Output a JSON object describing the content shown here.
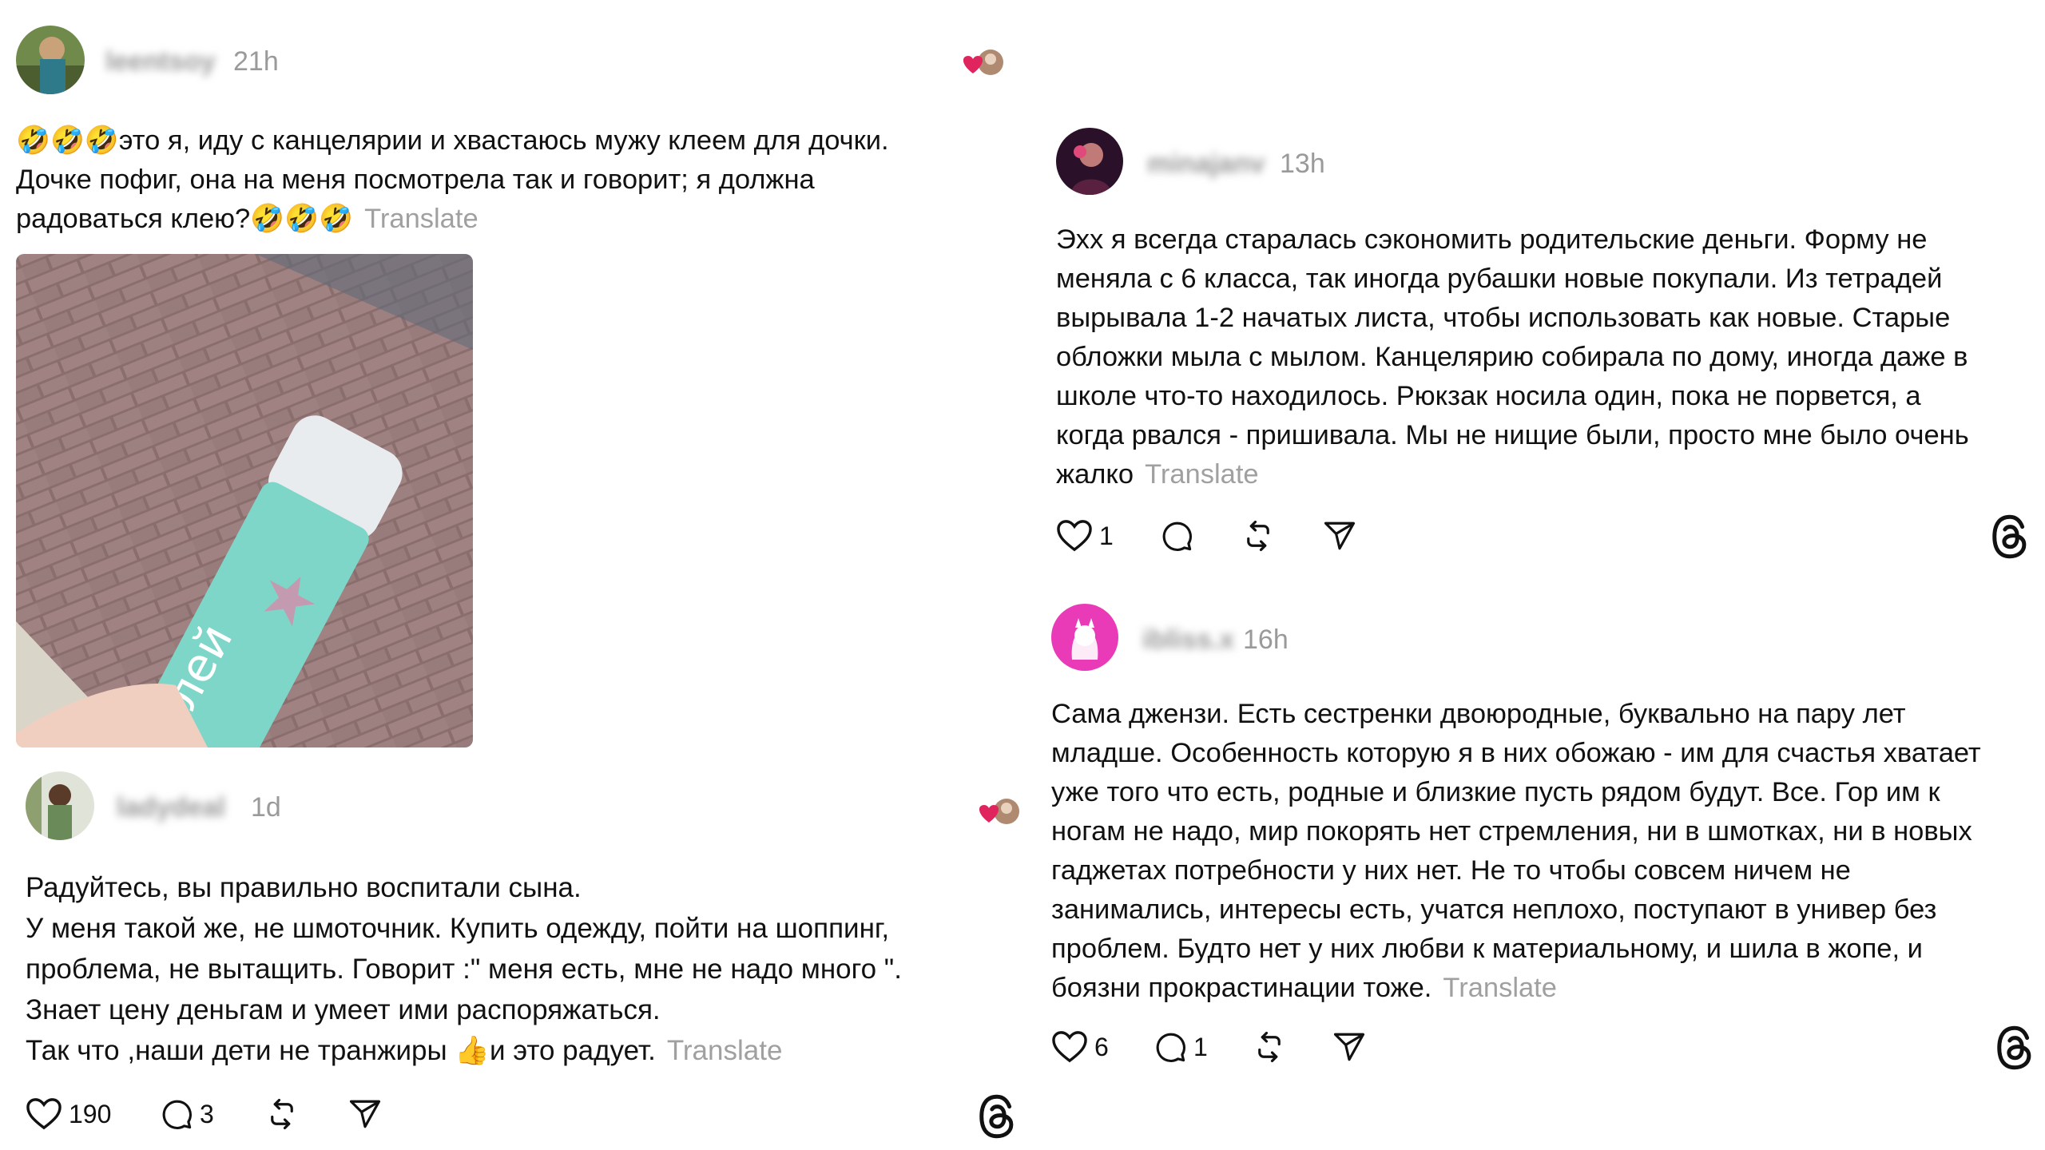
{
  "posts": {
    "p1": {
      "username": "leentsoy",
      "time": "21h",
      "text": "🤣🤣🤣это я, иду с канцелярии и хвастаюсь мужу клеем для дочки.\nДочке пофиг, она на меня посмотрела так и говорит; я должна\nрадоваться клею?🤣🤣🤣",
      "translate": "Translate",
      "image_brand": "клей"
    },
    "p2": {
      "username": "ladydeal",
      "time": "1d",
      "text": "Радуйтесь, вы правильно воспитали сына.\nУ меня такой же, не шмоточник. Купить одежду, пойти на шоппинг,\nпроблема, не вытащить. Говорит :\" меня есть, мне не надо много \".\nЗнает цену деньгам и умеет ими распоряжаться.\nТак что ,наши дети не транжиры 👍и это радует.",
      "translate": "Translate",
      "likes": "190",
      "replies": "3"
    },
    "p3": {
      "username": "minajanv",
      "time": "13h",
      "text": "Эхх я всегда старалась сэкономить родительские деньги. Форму не\nменяла с 6 класса, так иногда рубашки новые покупали. Из тетрадей\nвырывала 1-2 начатых листа, чтобы использовать как новые. Старые\nобложки мыла с мылом. Канцелярию собирала по дому, иногда даже в\nшколе что-то находилось. Рюкзак носила один, пока не порвется, а\nкогда рвался - пришивала. Мы не нищие были, просто мне было очень\nжалко",
      "translate": "Translate",
      "likes": "1"
    },
    "p4": {
      "username": "ibliss.x",
      "time": "16h",
      "text": "Сама джензи. Есть сестренки двоюродные, буквально на пару лет\nмладше. Особенность которую я в них обожаю - им для счастья хватает\nуже того что есть, родные и близкие пусть рядом будут. Все. Гор им к\nногам не надо, мир покорять нет стремления, ни в шмотках, ни в новых\nгаджетах потребности у них нет. Не то чтобы совсем ничем не\nзанимались, интересы есть, учатся неплохо, поступают в универ без\nпроблем. Будто нет у них любви к материальному, и шила в жопе, и\nбоязни прокрастинации тоже.",
      "translate": "Translate",
      "likes": "6",
      "replies": "1"
    }
  },
  "colors": {
    "muted": "#9a9a9a",
    "heart": "#e0245e",
    "avatar_pink": "#e93ab8"
  }
}
